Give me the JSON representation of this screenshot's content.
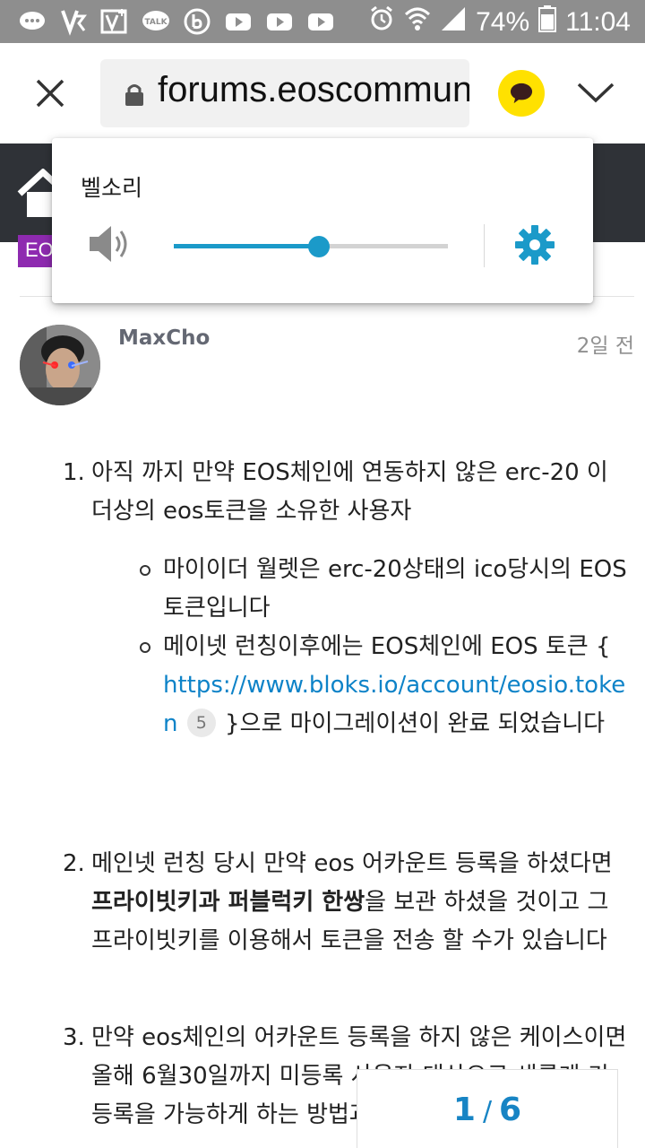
{
  "status_bar": {
    "icons": [
      "chat-bubbles-icon",
      "v3-icon",
      "v3-plus-icon",
      "talk-icon",
      "b-app-icon",
      "youtube-icon",
      "youtube-icon",
      "youtube-icon",
      "alarm-icon",
      "wifi-icon",
      "signal-icon"
    ],
    "battery": "74%",
    "time": "11:04"
  },
  "browser": {
    "url": "forums.eoscommunity.org"
  },
  "site_header": {
    "category_badge": "EOS"
  },
  "volume_popup": {
    "title": "벨소리",
    "level": 0.53
  },
  "post": {
    "username": "MaxCho",
    "date": "2일 전",
    "items": [
      {
        "num": "1.",
        "text": "아직 까지 만약 EOS체인에 연동하지 않은 erc-20 이더상의 eos토큰을 소유한 사용자",
        "sub": [
          {
            "text": "마이이더 월렛은 erc-20상태의 ico당시의 EOS 토큰입니다"
          },
          {
            "pre": "메이넷 런칭이후에는 EOS체인에 EOS 토큰 { ",
            "link": "https://www.bloks.io/account/eosio.token",
            "badge": "5",
            "post": " }으로 마이그레이션이 완료 되었습니다"
          }
        ]
      },
      {
        "num": "2.",
        "pre": "메인넷 런칭 당시 만약 eos 어카운트 등록을 하셨다면 ",
        "bold": "프라이빗키과 퍼블럭키 한쌍",
        "post": "을 보관 하셨을 것이고 그 프라이빗키를 이용해서 토큰을 전송 할 수가 있습니다"
      },
      {
        "num": "3.",
        "text": "만약 eos체인의 어카운트 등록을 하지 않은 케이스이면 올해 6월30일까지 미등록 사용자 대상으로 새롭게 키 등록을 가능하게 하는 방법과 영상을 링크로"
      }
    ]
  },
  "pager": {
    "current": "1",
    "total": "6"
  },
  "colors": {
    "status_bar_bg": "#8e8e8e",
    "header_bg": "#2f3237",
    "accent_blue": "#1b9ac9",
    "link_blue": "#0e83c8",
    "category_purple": "#8e2ab0",
    "kakao_yellow": "#ffe100"
  }
}
